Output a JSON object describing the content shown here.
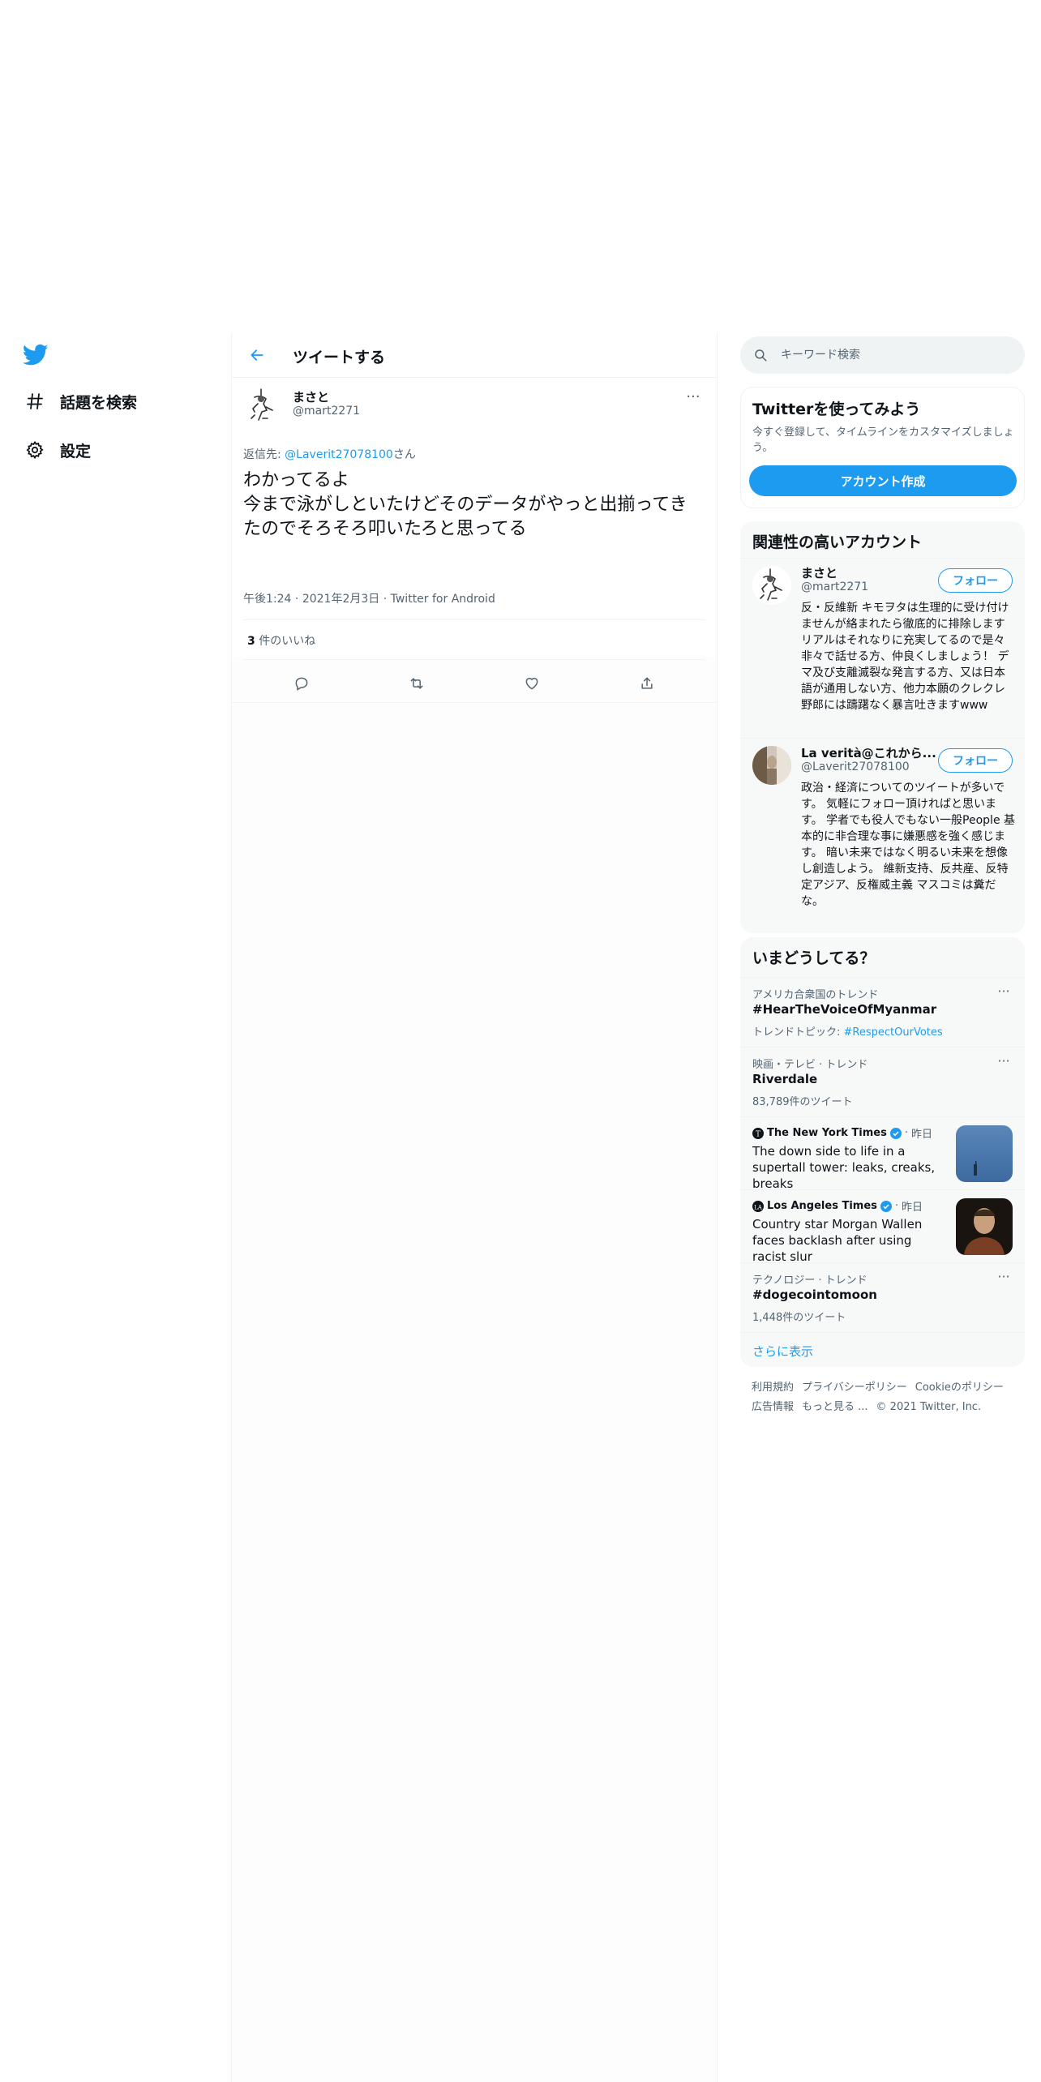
{
  "nav": {
    "items": [
      {
        "label": "話題を検索",
        "icon": "hashtag-icon"
      },
      {
        "label": "設定",
        "icon": "gear-icon"
      }
    ]
  },
  "header": {
    "title": "ツイートする"
  },
  "tweet": {
    "name": "まさと",
    "handle": "@mart2271",
    "reply_prefix": "返信先: ",
    "reply_to": "@Laverit27078100",
    "reply_suffix": "さん",
    "text": "わかってるよ\n今まで泳がしといたけどそのデータがやっと出揃ってきたのでそろそろ叩いたろと思ってる",
    "time": "午後1:24",
    "sep": " · ",
    "date": "2021年2月3日",
    "client": "Twitter for Android",
    "likes_count": "3",
    "likes_label": " 件のいいね"
  },
  "search": {
    "placeholder": "キーワード検索"
  },
  "signup": {
    "title": "Twitterを使ってみよう",
    "desc": "今すぐ登録して、タイムラインをカスタマイズしましょう。",
    "button": "アカウント作成"
  },
  "related": {
    "title": "関連性の高いアカウント",
    "accounts": [
      {
        "name": "まさと",
        "handle": "@mart2271",
        "follow": "フォロー",
        "bio": "反・反維新 キモヲタは生理的に受け付けませんが絡まれたら徹底的に排除します リアルはそれなりに充実してるので是々非々で話せる方、仲良くしましょう！ デマ及び支離滅裂な発言する方、又は日本語が通用しない方、他力本願のクレクレ野郎には躊躇なく暴言吐きますwww"
      },
      {
        "name": "La verità@これから...",
        "handle": "@Laverit27078100",
        "follow": "フォロー",
        "bio": "政治・経済についてのツイートが多いです。 気軽にフォロー頂ければと思います。 学者でも役人でもない一般People 基本的に非合理な事に嫌悪感を強く感じます。 暗い未来ではなく明るい未来を想像し創造しよう。 維新支持、反共産、反特定アジア、反権威主義 マスコミは糞だな。"
      }
    ]
  },
  "trends": {
    "title": "いまどうしてる？",
    "items": [
      {
        "context": "アメリカ合衆国のトレンド",
        "title": "#HearTheVoiceOfMyanmar",
        "sub_prefix": "トレンドトピック: ",
        "sub_link": "#RespectOurVotes"
      },
      {
        "context": "映画・テレビ · トレンド",
        "title": "Riverdale",
        "sub": "83,789件のツイート"
      },
      {
        "context": "テクノロジー · トレンド",
        "title": "#dogecointomoon",
        "sub": "1,448件のツイート"
      }
    ],
    "news": [
      {
        "source": "The New York Times",
        "time": "昨日",
        "headline": "The down side to life in a supertall tower: leaks, creaks, breaks"
      },
      {
        "source": "Los Angeles Times",
        "time": "昨日",
        "headline": "Country star Morgan Wallen faces backlash after using racist slur"
      }
    ],
    "show_more": "さらに表示"
  },
  "footer": {
    "links": [
      "利用規約",
      "プライバシーポリシー",
      "Cookieのポリシー",
      "広告情報",
      "もっと見る ..."
    ],
    "copyright": "© 2021 Twitter, Inc."
  },
  "colors": {
    "accent": "#1d9bf0",
    "text": "#0f1419",
    "secondary": "#536471",
    "border": "#eff3f4"
  }
}
